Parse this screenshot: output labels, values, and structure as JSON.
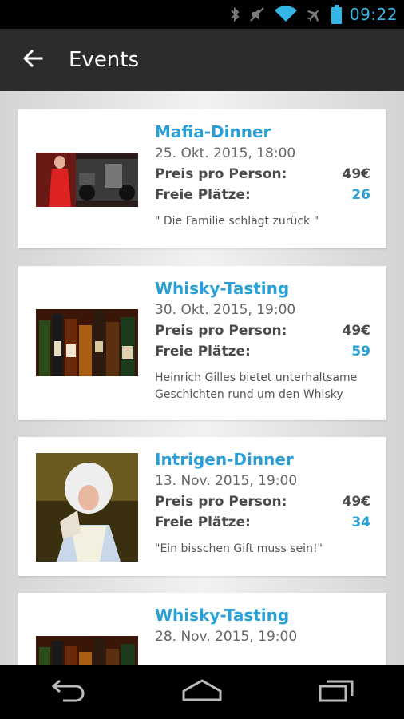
{
  "status_bar": {
    "time": "09:22",
    "icons": [
      "bluetooth-icon",
      "mute-icon",
      "wifi-icon",
      "airplane-icon",
      "battery-icon"
    ]
  },
  "action_bar": {
    "title": "Events",
    "back_icon": "arrow-left-icon"
  },
  "labels": {
    "price": "Preis pro Person:",
    "seats": "Freie Plätze:"
  },
  "events": [
    {
      "title": "Mafia-Dinner",
      "date": "25. Okt. 2015, 18:00",
      "price": "49€",
      "seats": "26",
      "description": "\" Die Familie schlägt zurück \""
    },
    {
      "title": "Whisky-Tasting",
      "date": "30. Okt. 2015, 19:00",
      "price": "49€",
      "seats": "59",
      "description": "Heinrich Gilles bietet unterhaltsame Geschichten rund um den Whisky"
    },
    {
      "title": "Intrigen-Dinner",
      "date": "13. Nov. 2015, 19:00",
      "price": "49€",
      "seats": "34",
      "description": "\"Ein bisschen Gift muss sein!\""
    },
    {
      "title": "Whisky-Tasting",
      "date": "28. Nov. 2015, 19:00"
    }
  ],
  "nav_bar": [
    "back-nav-icon",
    "home-nav-icon",
    "recents-nav-icon"
  ],
  "colors": {
    "accent": "#2a9fd6",
    "status_accent": "#33b5e5",
    "action_bar": "#2c2c2c"
  }
}
